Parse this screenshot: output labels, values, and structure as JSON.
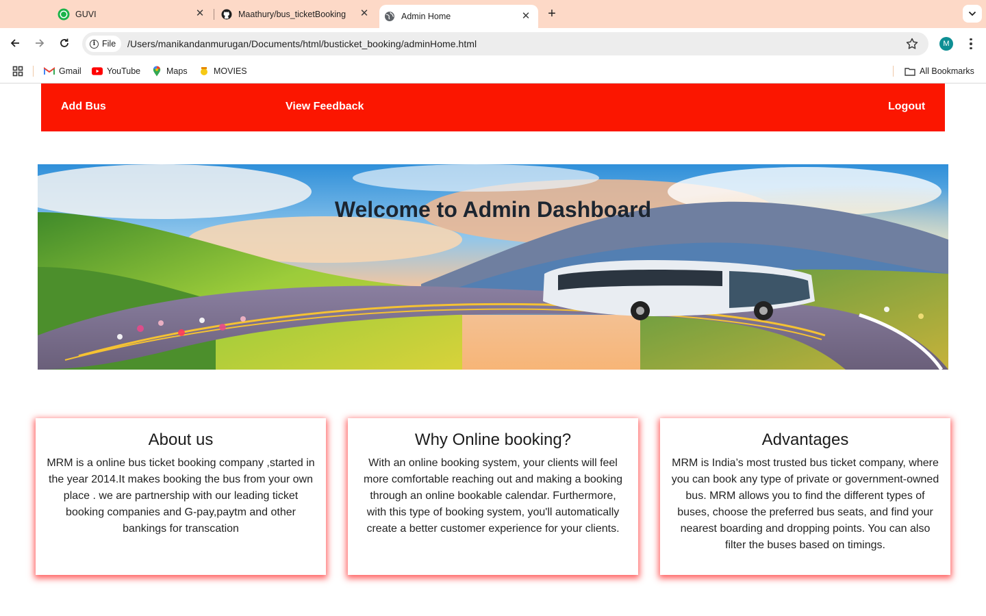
{
  "browser": {
    "tabs": [
      {
        "title": "GUVI",
        "icon": "guvi-icon"
      },
      {
        "title": "Maathury/bus_ticketBooking",
        "icon": "github-icon"
      },
      {
        "title": "Admin Home",
        "icon": "globe-icon",
        "active": true
      }
    ],
    "url_scheme_label": "File",
    "url": "/Users/manikandanmurugan/Documents/html/busticket_booking/adminHome.html",
    "profile_initial": "M",
    "bookmarks": [
      {
        "label": "Gmail",
        "icon": "gmail-icon"
      },
      {
        "label": "YouTube",
        "icon": "youtube-icon"
      },
      {
        "label": "Maps",
        "icon": "maps-icon"
      },
      {
        "label": "MOVIES",
        "icon": "movies-icon"
      }
    ],
    "all_bookmarks_label": "All Bookmarks"
  },
  "nav": {
    "add_bus": "Add Bus",
    "view_feedback": "View Feedback",
    "logout": "Logout"
  },
  "hero": {
    "title": "Welcome to Admin Dashboard"
  },
  "cards": [
    {
      "title": "About us",
      "text": "MRM is a online bus ticket booking company ,started in the year 2014.It makes booking the bus from your own place . we are partnership with our leading ticket booking companies and G-pay,paytm and other bankings for transcation"
    },
    {
      "title": "Why Online booking?",
      "text": "With an online booking system, your clients will feel more comfortable reaching out and making a booking through an online bookable calendar. Furthermore, with this type of booking system, you'll automatically create a better customer experience for your clients."
    },
    {
      "title": "Advantages",
      "text": "MRM is India’s most trusted bus ticket company, where you can book any type of private or government-owned bus. MRM allows you to find the different types of buses, choose the preferred bus seats, and find your nearest boarding and dropping points. You can also filter the buses based on timings."
    }
  ],
  "colors": {
    "tabstrip": "#fdd9c7",
    "navbar": "#fb1600",
    "card_shadow": "#ff2828",
    "avatar": "#0e8f94"
  }
}
